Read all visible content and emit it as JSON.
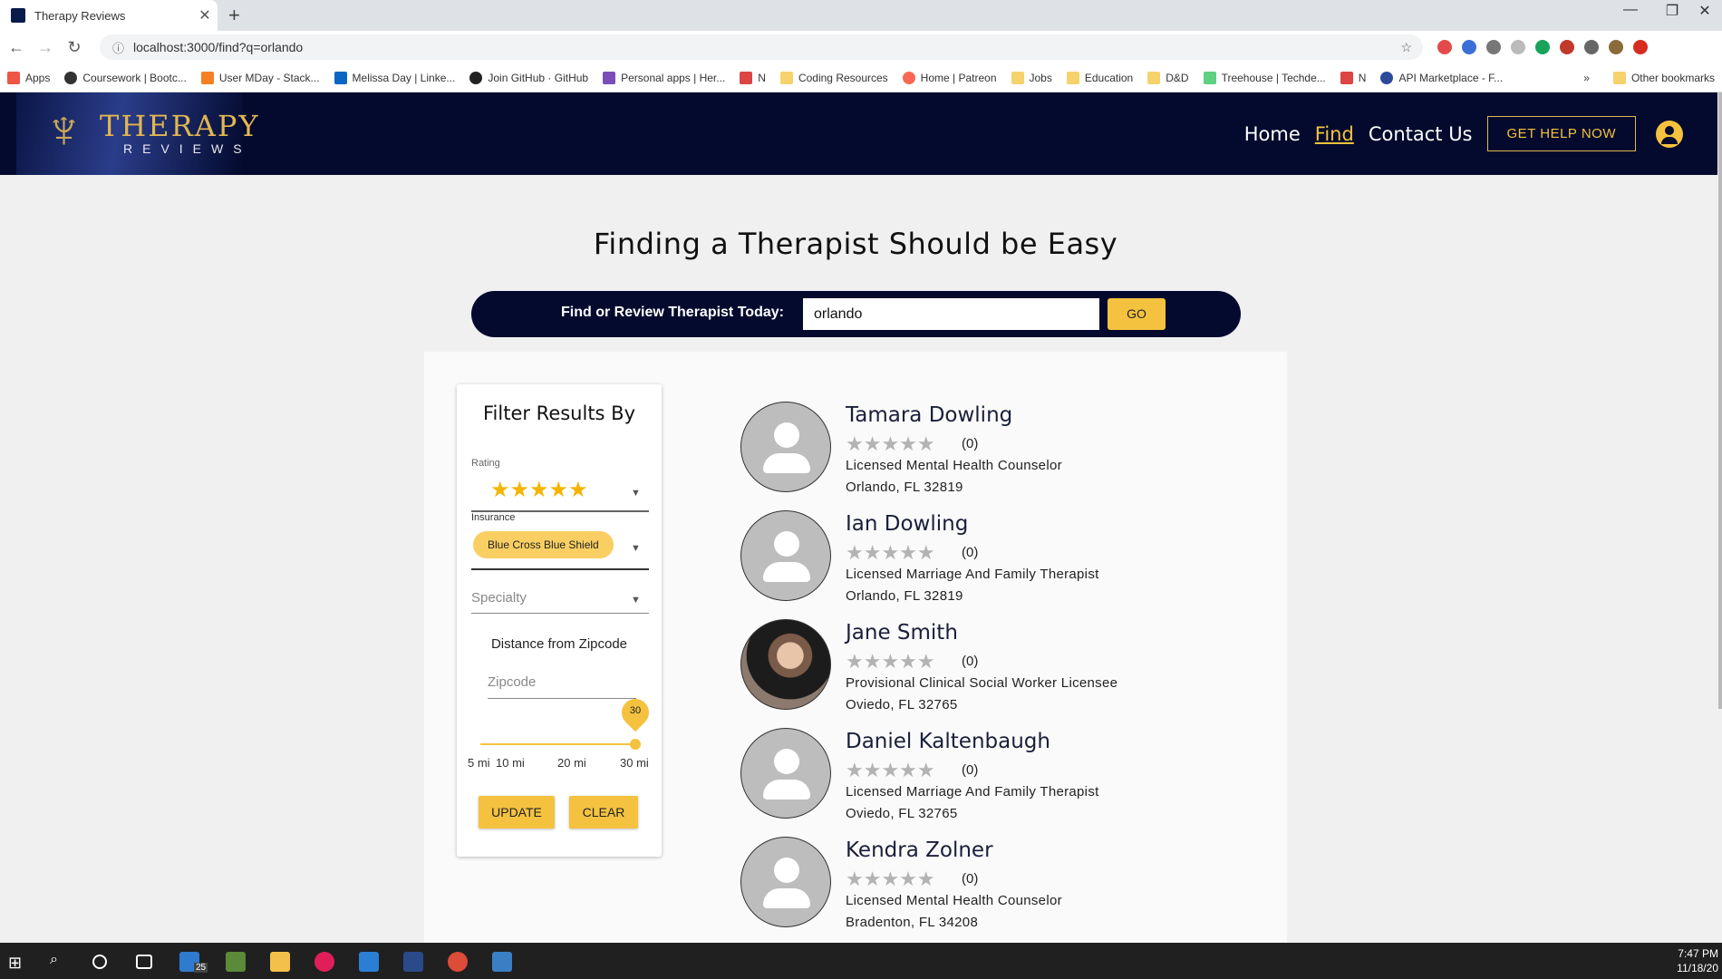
{
  "browser": {
    "tab_title": "Therapy Reviews",
    "new_tab": "+",
    "url": "localhost:3000/find?q=orlando",
    "win_min": "—",
    "win_max": "❐",
    "win_close": "✕"
  },
  "bookmarks": [
    "Apps",
    "Coursework | Bootc...",
    "User MDay - Stack...",
    "Melissa Day | Linke...",
    "Join GitHub · GitHub",
    "Personal apps | Her...",
    "N",
    "Coding Resources",
    "Home | Patreon",
    "Jobs",
    "Education",
    "D&D",
    "Treehouse | Techde...",
    "N",
    "API Marketplace - F..."
  ],
  "bookmarks_more": "»",
  "bookmarks_other": "Other bookmarks",
  "site": {
    "logo_title": "THERAPY",
    "logo_sub": "REVIEWS",
    "nav_home": "Home",
    "nav_find": "Find",
    "nav_contact": "Contact Us",
    "help_button": "GET HELP NOW",
    "accent": "#f4c23f",
    "navy": "#030a2e"
  },
  "hero": {
    "title": "Finding a Therapist Should be Easy",
    "search_label": "Find or Review Therapist Today:",
    "search_value": "orlando",
    "go_button": "GO"
  },
  "filter": {
    "title": "Filter Results By",
    "rating_label": "Rating",
    "rating_value": 5,
    "rating_stars": "★★★★★",
    "insurance_label": "Insurance",
    "insurance_selected": "Blue Cross Blue Shield",
    "specialty_placeholder": "Specialty",
    "distance_label": "Distance from Zipcode",
    "zipcode_placeholder": "Zipcode",
    "distance_value": "30",
    "marks": [
      "5 mi",
      "10 mi",
      "20 mi",
      "30 mi"
    ],
    "update_button": "UPDATE",
    "clear_button": "CLEAR"
  },
  "therapists": [
    {
      "name": "Tamara Dowling",
      "stars": "★★★★★",
      "rating_count": "(0)",
      "title": "Licensed Mental Health Counselor",
      "location": "Orlando, FL 32819",
      "photo": false
    },
    {
      "name": "Ian Dowling",
      "stars": "★★★★★",
      "rating_count": "(0)",
      "title": "Licensed Marriage And Family Therapist",
      "location": "Orlando, FL 32819",
      "photo": false
    },
    {
      "name": "Jane Smith",
      "stars": "★★★★★",
      "rating_count": "(0)",
      "title": "Provisional Clinical Social Worker Licensee",
      "location": "Oviedo, FL 32765",
      "photo": true
    },
    {
      "name": "Daniel Kaltenbaugh",
      "stars": "★★★★★",
      "rating_count": "(0)",
      "title": "Licensed Marriage And Family Therapist",
      "location": "Oviedo, FL 32765",
      "photo": false
    },
    {
      "name": "Kendra Zolner",
      "stars": "★★★★★",
      "rating_count": "(0)",
      "title": "Licensed Mental Health Counselor",
      "location": "Bradenton, FL 34208",
      "photo": false
    }
  ],
  "taskbar": {
    "time": "7:47 PM",
    "date": "11/18/20",
    "mail_badge": "25"
  }
}
